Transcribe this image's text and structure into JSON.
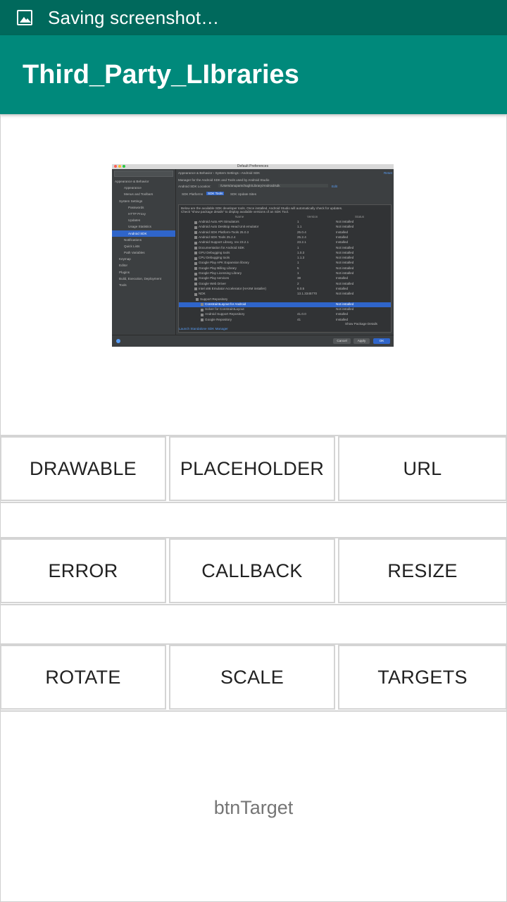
{
  "status_bar": {
    "text": "Saving screenshot…",
    "icon": "image-icon"
  },
  "app_bar": {
    "title": "Third_Party_LIbraries"
  },
  "preview": {
    "window_title": "Default Preferences",
    "sidebar_items": [
      "Appearance & Behavior",
      "Appearance",
      "Menus and Toolbars",
      "System Settings",
      "Passwords",
      "HTTP Proxy",
      "Updates",
      "Usage Statistics",
      "Android SDK",
      "Notifications",
      "Quick Lists",
      "Path Variables",
      "Keymap",
      "Editor",
      "Plugins",
      "Build, Execution, Deployment",
      "Tools"
    ],
    "breadcrumb": "Appearance & Behavior › System Settings › Android SDK",
    "reset": "Reset",
    "manager_text": "Manager for the Android SDK and Tools used by Android Studio",
    "sdk_location_label": "Android SDK Location:",
    "sdk_location_value": "/Users/anupamchugh/Library/Android/sdk",
    "edit": "Edit",
    "tabs": [
      "SDK Platforms",
      "SDK Tools",
      "SDK Update Sites"
    ],
    "description": "Below are the available SDK developer tools. Once installed, Android Studio will automatically check for updates. Check \"show package details\" to display available versions of an SDK Tool.",
    "columns": [
      "Name",
      "Version",
      "Status"
    ],
    "rows": [
      [
        "Android Auto API Simulators",
        "1",
        "Not installed"
      ],
      [
        "Android Auto Desktop Head Unit emulator",
        "1.1",
        "Not installed"
      ],
      [
        "Android SDK Platform-Tools 25.0.3",
        "25.0.4",
        "Installed"
      ],
      [
        "Android SDK Tools 25.2.4",
        "25.2.4",
        "Installed"
      ],
      [
        "Android Support Library, rev 23.2.1",
        "23.2.1",
        "Installed"
      ],
      [
        "Documentation for Android SDK",
        "1",
        "Not installed"
      ],
      [
        "GPU Debugging tools",
        "1.0.3",
        "Not installed"
      ],
      [
        "CPU Debugging tools",
        "1.1.3",
        "Not installed"
      ],
      [
        "Google Play APK Expansion library",
        "1",
        "Not installed"
      ],
      [
        "Google Play Billing Library",
        "5",
        "Not installed"
      ],
      [
        "Google Play Licensing Library",
        "1",
        "Not installed"
      ],
      [
        "Google Play services",
        "38",
        "Installed"
      ],
      [
        "Google Web Driver",
        "2",
        "Not installed"
      ],
      [
        "Intel x86 Emulator Accelerator (HAXM installer)",
        "6.0.5",
        "Installed"
      ],
      [
        "NDK",
        "13.1.3345770",
        "Not installed"
      ],
      [
        "Support Repository",
        "",
        ""
      ],
      [
        "ConstraintLayout for Android",
        "",
        "Not installed"
      ],
      [
        "Solver for ConstraintLayout",
        "",
        "Not installed"
      ],
      [
        "Android Support Repository",
        "41.0.0",
        "Installed"
      ],
      [
        "Google Repository",
        "41",
        "Installed"
      ]
    ],
    "show_package_details": "Show Package Details",
    "launch_link": "Launch Standalone SDK Manager",
    "buttons": [
      "Cancel",
      "Apply",
      "OK"
    ]
  },
  "buttons": {
    "drawable": "DRAWABLE",
    "placeholder": "PLACEHOLDER",
    "url": "URL",
    "error": "ERROR",
    "callback": "CALLBACK",
    "resize": "RESIZE",
    "rotate": "ROTATE",
    "scale": "SCALE",
    "targets": "TARGETS"
  },
  "target_label": "btnTarget"
}
